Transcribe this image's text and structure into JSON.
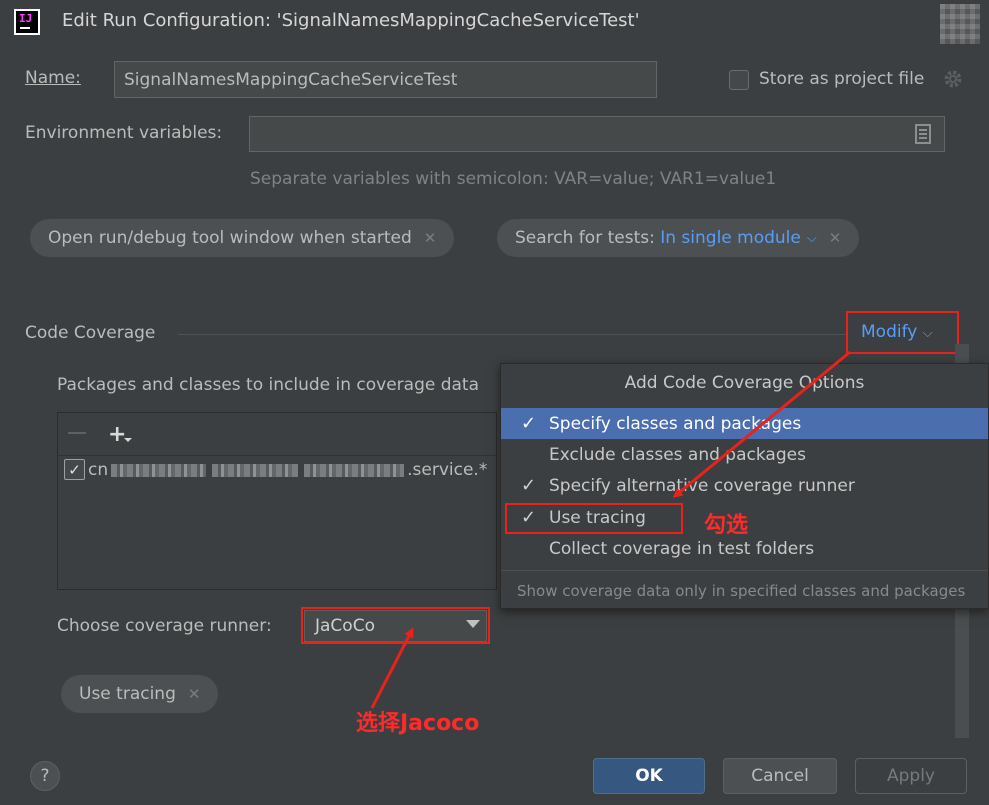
{
  "window": {
    "title": "Edit Run Configuration: 'SignalNamesMappingCacheServiceTest'"
  },
  "form": {
    "name_label": "Name:",
    "name_value": "SignalNamesMappingCacheServiceTest",
    "store_label": "Store as project file",
    "env_label": "Environment variables:",
    "env_value": "",
    "env_hint": "Separate variables with semicolon: VAR=value; VAR1=value1"
  },
  "chips": {
    "open_tool_window": "Open run/debug tool window when started",
    "search_prefix": "Search for tests:",
    "search_value": "In single module",
    "use_tracing": "Use tracing"
  },
  "coverage": {
    "section_title": "Code Coverage",
    "modify_label": "Modify",
    "packages_label": "Packages and classes to include in coverage data",
    "package_prefix": "cn",
    "package_suffix": ".service.*",
    "runner_label": "Choose coverage runner:",
    "runner_value": "JaCoCo"
  },
  "popup": {
    "header": "Add Code Coverage Options",
    "items": [
      {
        "label": "Specify classes and packages",
        "checked": true,
        "selected": true
      },
      {
        "label": "Exclude classes and packages",
        "checked": false,
        "selected": false
      },
      {
        "label": "Specify alternative coverage runner",
        "checked": true,
        "selected": false
      },
      {
        "label": "Use tracing",
        "checked": true,
        "selected": false
      },
      {
        "label": "Collect coverage in test folders",
        "checked": false,
        "selected": false
      }
    ],
    "hint": "Show coverage data only in specified classes and packages"
  },
  "buttons": {
    "ok": "OK",
    "cancel": "Cancel",
    "apply": "Apply",
    "help": "?"
  },
  "annotations": {
    "check_note": "勾选",
    "select_note": "选择Jacoco",
    "color": "#e8221c"
  }
}
